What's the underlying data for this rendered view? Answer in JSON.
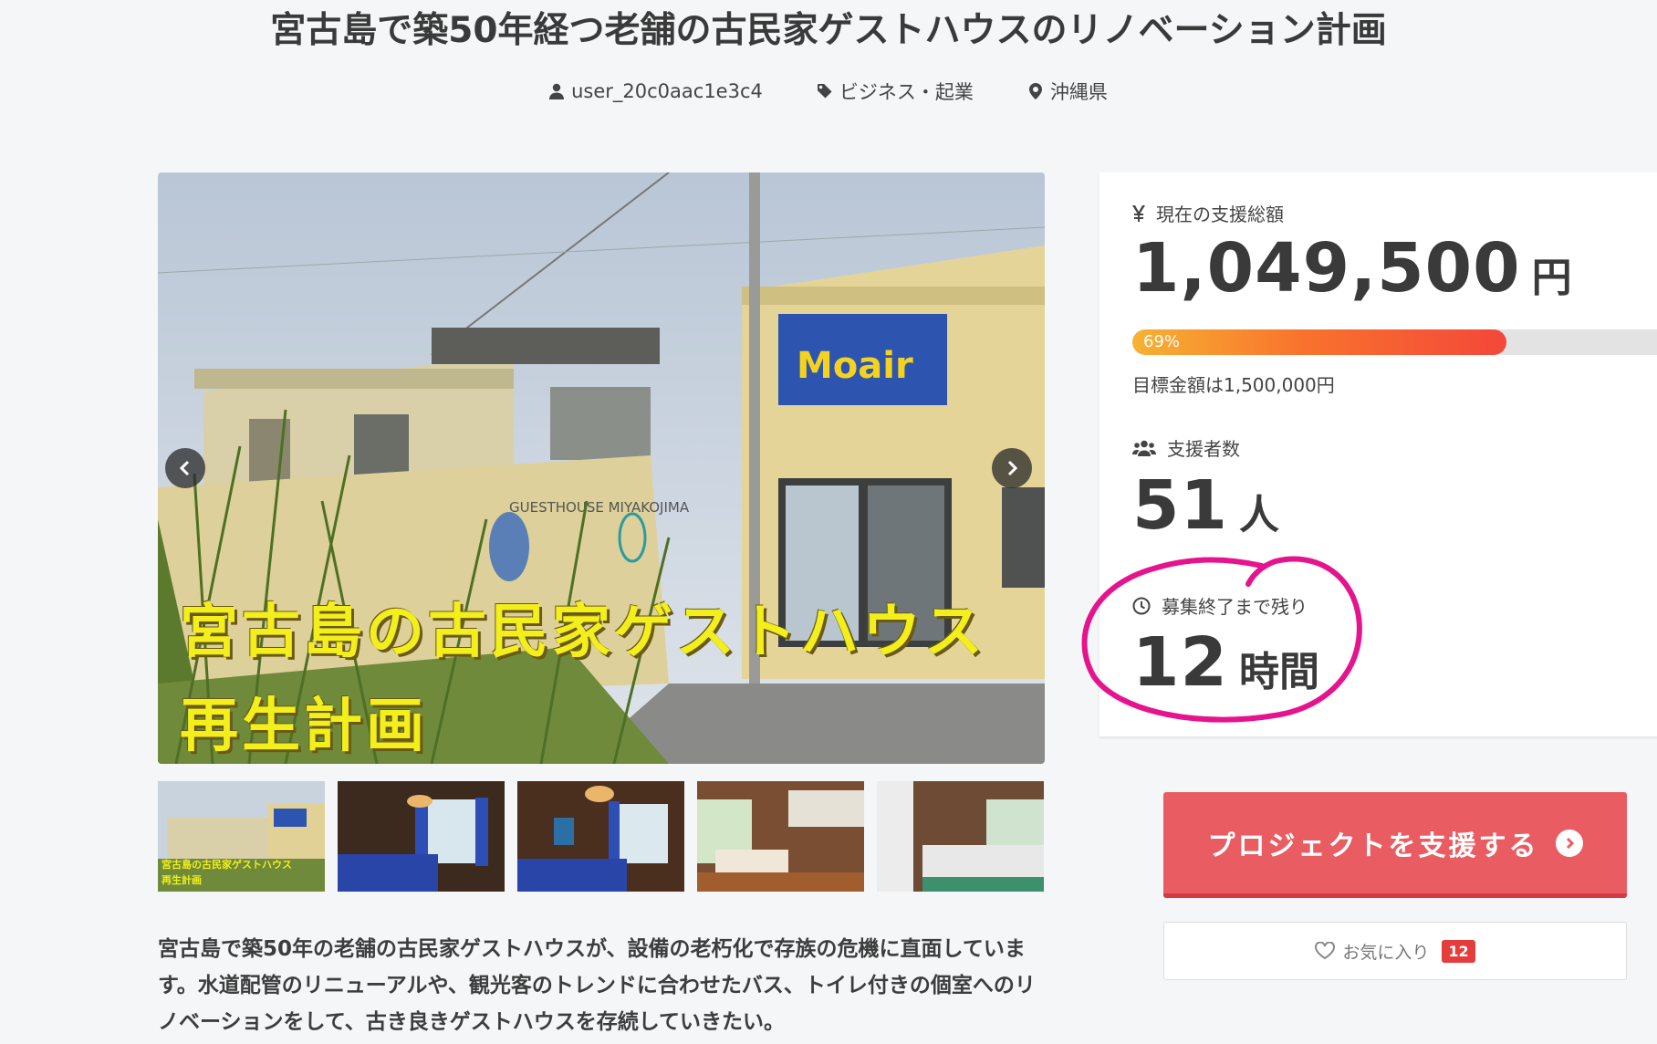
{
  "project": {
    "title": "宮古島で築50年経つ老舗の古民家ゲストハウスのリノベーション計画",
    "owner": "user_20c0aac1e3c4",
    "category": "ビジネス・起業",
    "location": "沖縄県",
    "image_caption_line1": "宮古島の古民家ゲストハウス",
    "image_caption_line2": "再生計画",
    "image_sign_text": "GUESTHOUSE MIYAKOJIMA",
    "image_banner_text": "Moair",
    "thumbnail_caption_line1": "宮古島の古民家ゲストハウス",
    "thumbnail_caption_line2": "再生計画",
    "description": "宮古島で築50年の老舗の古民家ゲストハウスが、設備の老朽化で存族の危機に直面しています。水道配管のリニューアルや、観光客のトレンドに合わせたバス、トイレ付きの個室へのリノベーションをして、古き良きゲストハウスを存続していきたい。"
  },
  "stats": {
    "total_label": "現在の支援総額",
    "total_amount": "1,049,500",
    "total_unit": "円",
    "progress_percent": 69,
    "progress_label": "69%",
    "goal_text": "目標金額は1,500,000円",
    "backers_label": "支援者数",
    "backers_count": "51",
    "backers_unit": "人",
    "remaining_label": "募集終了まで残り",
    "remaining_value": "12",
    "remaining_unit": "時間"
  },
  "actions": {
    "support_label": "プロジェクトを支援する",
    "favorite_label": "お気に入り",
    "favorite_count": "12"
  },
  "colors": {
    "accent": "#e95d62",
    "highlight_circle": "#e5138e",
    "progress_start": "#f7b233",
    "progress_end": "#f4473a",
    "badge": "#e53c3c"
  },
  "icons": [
    "user-icon",
    "tag-icon",
    "map-pin-icon",
    "yen-icon",
    "users-icon",
    "clock-icon",
    "chevron-left-icon",
    "chevron-right-icon",
    "heart-icon",
    "arrow-circle-right-icon"
  ]
}
